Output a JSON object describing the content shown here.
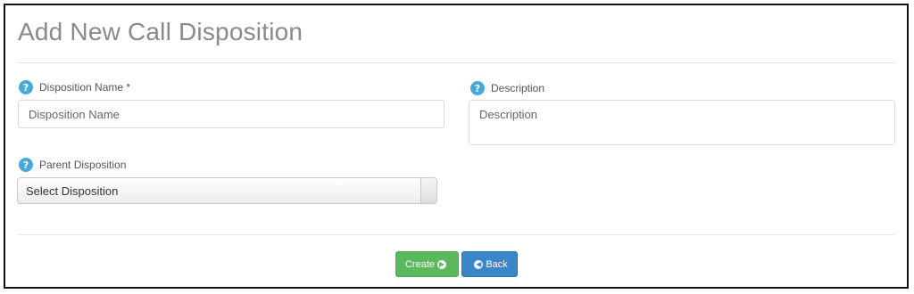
{
  "page": {
    "title": "Add New Call Disposition"
  },
  "form": {
    "disposition_name": {
      "label": "Disposition Name *",
      "placeholder": "Disposition Name",
      "value": ""
    },
    "description": {
      "label": "Description",
      "placeholder": "Description",
      "value": ""
    },
    "parent_disposition": {
      "label": "Parent Disposition",
      "selected": "Select Disposition"
    }
  },
  "actions": {
    "create_label": "Create",
    "back_label": "Back"
  },
  "icons": {
    "help": "question-circle-icon",
    "create": "arrow-circle-right-icon",
    "back": "arrow-circle-left-icon"
  },
  "colors": {
    "help": "#4aa8d8",
    "create": "#5cb85c",
    "back": "#3a86c9"
  }
}
